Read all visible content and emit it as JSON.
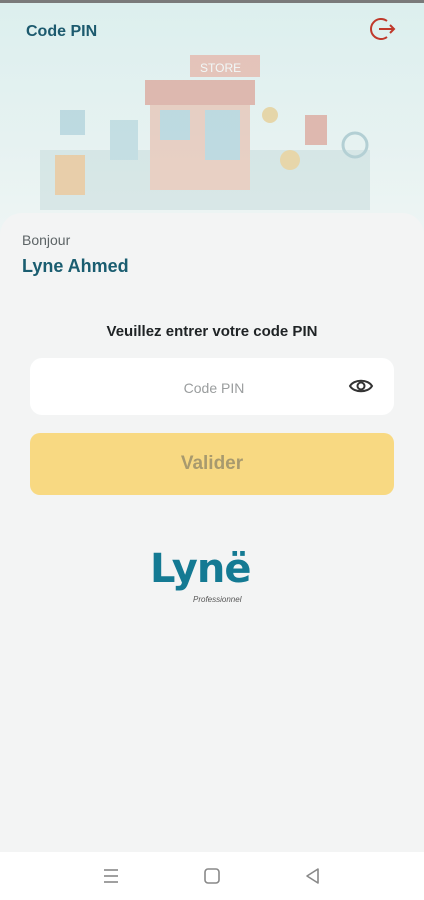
{
  "header": {
    "title": "Code PIN",
    "logout_icon": "logout-icon",
    "illustration_store_label": "STORE"
  },
  "greeting": {
    "hello": "Bonjour",
    "user_name": "Lyne Ahmed"
  },
  "pin_form": {
    "prompt": "Veuillez entrer votre code PIN",
    "placeholder": "Code PIN",
    "value": "",
    "toggle_icon": "eye-icon",
    "submit_label": "Valider"
  },
  "brand": {
    "logo_text": "Lynë",
    "logo_subtitle": "Professionnel",
    "colors": {
      "primary": "#147a93",
      "accent": "#f5a623",
      "button": "#f8d982"
    }
  },
  "system_nav": {
    "menu_icon": "menu-icon",
    "home_icon": "home-square-icon",
    "back_icon": "back-triangle-icon"
  }
}
